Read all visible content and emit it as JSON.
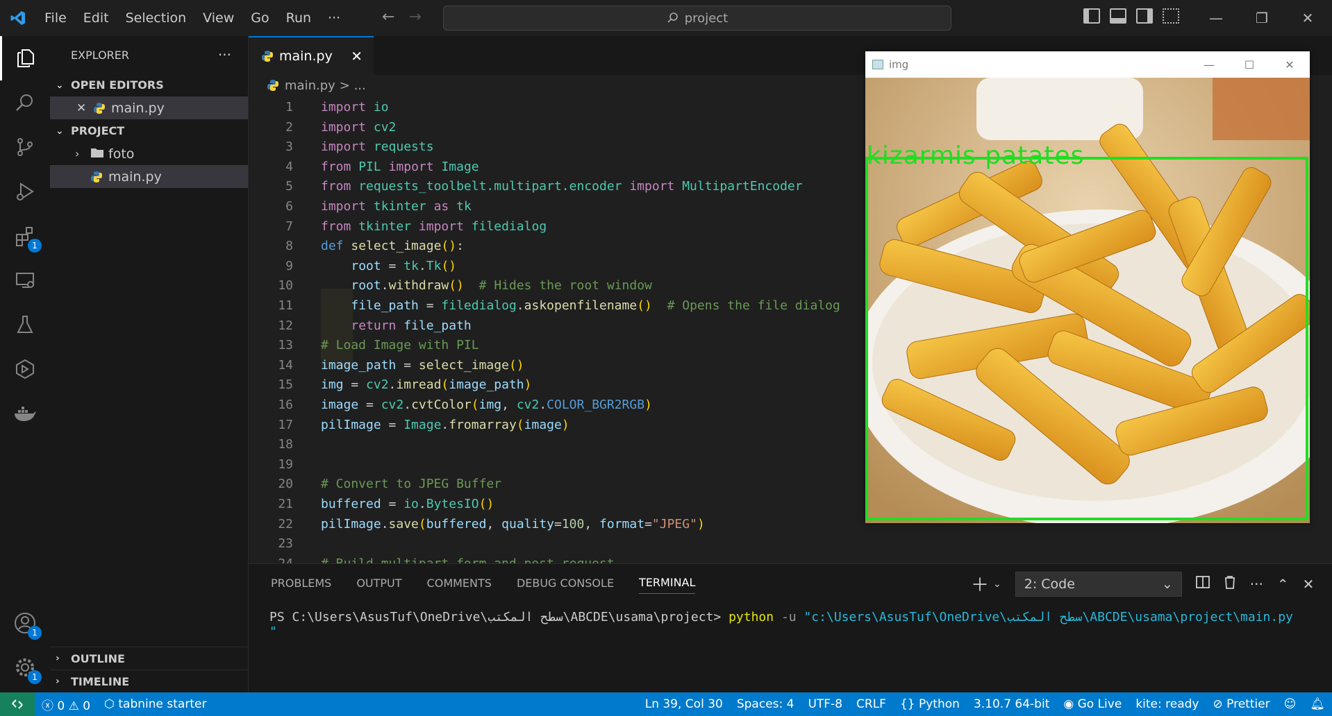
{
  "menu": [
    "File",
    "Edit",
    "Selection",
    "View",
    "Go",
    "Run",
    "···"
  ],
  "search": {
    "text": "project"
  },
  "explorer": {
    "title": "EXPLORER",
    "more": "···",
    "open_editors": "OPEN EDITORS",
    "open_file": "main.py",
    "project": "PROJECT",
    "folder": "foto",
    "file": "main.py",
    "outline": "OUTLINE",
    "timeline": "TIMELINE"
  },
  "badges": {
    "extensions": "1",
    "accounts": "1",
    "settings": "1"
  },
  "tab": {
    "label": "main.py"
  },
  "breadcrumb": {
    "file": "main.py",
    "sep": "> ..."
  },
  "code_lines": [
    "1",
    "2",
    "3",
    "4",
    "5",
    "6",
    "7",
    "8",
    "9",
    "10",
    "11",
    "12",
    "13",
    "14",
    "15",
    "16",
    "17",
    "18",
    "19",
    "20",
    "21",
    "22",
    "23",
    "24"
  ],
  "panel": {
    "tabs": [
      "PROBLEMS",
      "OUTPUT",
      "COMMENTS",
      "DEBUG CONSOLE",
      "TERMINAL"
    ],
    "terminal_select": "2: Code",
    "prompt": "PS C:\\Users\\AsusTuf\\OneDrive\\سطح المكتب\\ABCDE\\usama\\project>",
    "cmd": "python",
    "flag": " -u ",
    "path": "\"c:\\Users\\AsusTuf\\OneDrive\\سطح المكتب\\ABCDE\\usama\\project\\main.py",
    "cont": "\""
  },
  "image_window": {
    "title": "img",
    "label": "kizarmis patates"
  },
  "status": {
    "errors": "0",
    "warnings": "0",
    "tabnine": "tabnine starter",
    "position": "Ln 39, Col 30",
    "spaces": "Spaces: 4",
    "encoding": "UTF-8",
    "eol": "CRLF",
    "language": "Python",
    "interpreter": "3.10.7 64-bit",
    "golive": "Go Live",
    "kite": "kite: ready",
    "prettier": "Prettier"
  },
  "colors": {
    "accent": "#007acc",
    "detection_box": "#22dd22"
  }
}
